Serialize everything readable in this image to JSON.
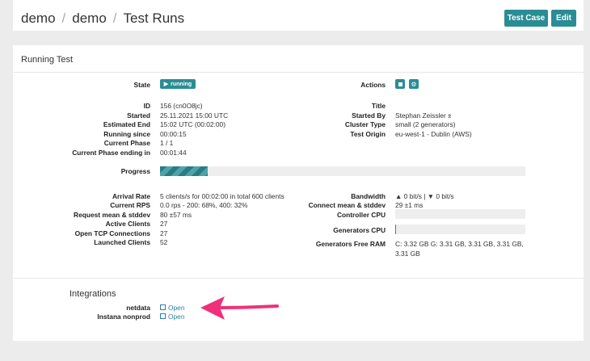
{
  "header": {
    "breadcrumb": [
      "demo",
      "demo",
      "Test Runs"
    ],
    "test_case_label": "Test Case",
    "edit_label": "Edit"
  },
  "running_test": {
    "title": "Running Test",
    "state_label": "State",
    "state_value": "running",
    "actions_label": "Actions",
    "left_fields": [
      {
        "label": "ID",
        "value": "156 (cn0O8jc)"
      },
      {
        "label": "Started",
        "value": "25.11.2021 15:00 UTC"
      },
      {
        "label": "Estimated End",
        "value": "15:02 UTC (00:02:00)"
      },
      {
        "label": "Running since",
        "value": "00:00:15"
      },
      {
        "label": "Current Phase",
        "value": "1 / 1"
      },
      {
        "label": "Current Phase ending in",
        "value": "00:01:44"
      }
    ],
    "right_fields": [
      {
        "label": "Title",
        "value": ""
      },
      {
        "label": "Started By",
        "value": "Stephan Zeissler"
      },
      {
        "label": "Cluster Type",
        "value": "small (2 generators)"
      },
      {
        "label": "Test Origin",
        "value": "eu-west-1 - Dublin (AWS)"
      }
    ],
    "progress_label": "Progress",
    "progress_fraction": 0.13,
    "stats_left": [
      {
        "label": "Arrival Rate",
        "value": "5 clients/s for 00:02:00 in total 600 clients"
      },
      {
        "label": "Current RPS",
        "value": "0.0  rps - 200: 68%, 400: 32%"
      },
      {
        "label": "Request mean & stddev",
        "value": "80 ±57 ms"
      },
      {
        "label": "Active Clients",
        "value": "27"
      },
      {
        "label": "Open TCP Connections",
        "value": "27"
      },
      {
        "label": "Launched Clients",
        "value": "52"
      }
    ],
    "bandwidth_label": "Bandwidth",
    "bandwidth_value": "▲ 0 bit/s | ▼ 0 bit/s",
    "connect_label": "Connect mean & stddev",
    "connect_value": "29 ±1 ms",
    "controller_cpu_label": "Controller CPU",
    "generators_cpu_label": "Generators CPU",
    "ram_label": "Generators Free RAM",
    "ram_value_line1": "C: 3.32 GB G: 3.31 GB, 3.31 GB, 3.31 GB,",
    "ram_value_line2": "3.31 GB"
  },
  "integrations": {
    "title": "Integrations",
    "items": [
      {
        "label": "netdata",
        "link": "Open"
      },
      {
        "label": "Instana nonprod",
        "link": "Open"
      }
    ]
  },
  "colors": {
    "accent": "#2a8d95",
    "arrow": "#f0307a",
    "link": "#2f7ea6"
  },
  "icons": [
    "play-icon",
    "stop-icon",
    "gear-icon",
    "user-tag-icon",
    "external-link-icon",
    "arrow-annotation"
  ]
}
